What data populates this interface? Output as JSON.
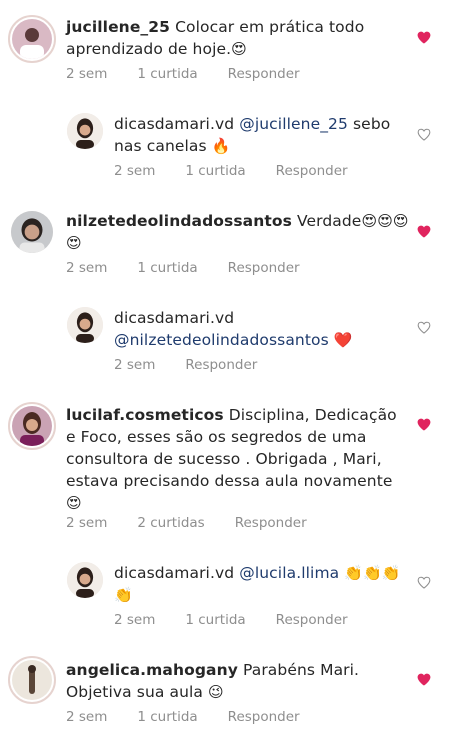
{
  "comments": [
    {
      "username": "jucillene_25",
      "text": " Colocar em prática todo aprendizado de hoje.",
      "emoji": "😍",
      "time": "2 sem",
      "likes": "1 curtida",
      "reply": "Responder",
      "liked": true
    },
    {
      "username": "dicasdamari.vd",
      "mention": "@jucillene_25",
      "text": " sebo nas canelas ",
      "emoji": "🔥",
      "time": "2 sem",
      "likes": "1 curtida",
      "reply": "Responder",
      "liked": false
    },
    {
      "username": "nilzetedeolindadossantos",
      "text": " Verdade",
      "emoji": "😍😍😍😍",
      "time": "2 sem",
      "likes": "1 curtida",
      "reply": "Responder",
      "liked": true
    },
    {
      "username": "dicasdamari.vd",
      "mention": "@nilzetedeolindadossantos",
      "text": " ",
      "emoji": "❤️",
      "time": "2 sem",
      "reply": "Responder",
      "liked": false
    },
    {
      "username": "lucilaf.cosmeticos",
      "text": " Disciplina, Dedicação e Foco, esses são os segredos de uma consultora de sucesso . Obrigada , Mari, estava precisando dessa aula novamente",
      "emoji": "😍",
      "time": "2 sem",
      "likes": "2 curtidas",
      "reply": "Responder",
      "liked": true
    },
    {
      "username": "dicasdamari.vd",
      "mention": "@lucila.llima",
      "text": " ",
      "emoji": "👏👏👏👏",
      "time": "2 sem",
      "likes": "1 curtida",
      "reply": "Responder",
      "liked": false
    },
    {
      "username": "angelica.mahogany",
      "text": " Parabéns Mari. Objetiva sua aula ",
      "emoji": "😉",
      "time": "2 sem",
      "likes": "1 curtida",
      "reply": "Responder",
      "liked": true
    }
  ],
  "colors": {
    "liked_heart": "#e0245e",
    "unliked_heart": "#8e8e8e",
    "mention": "#1f3b6d",
    "meta": "#8e8e8e"
  }
}
